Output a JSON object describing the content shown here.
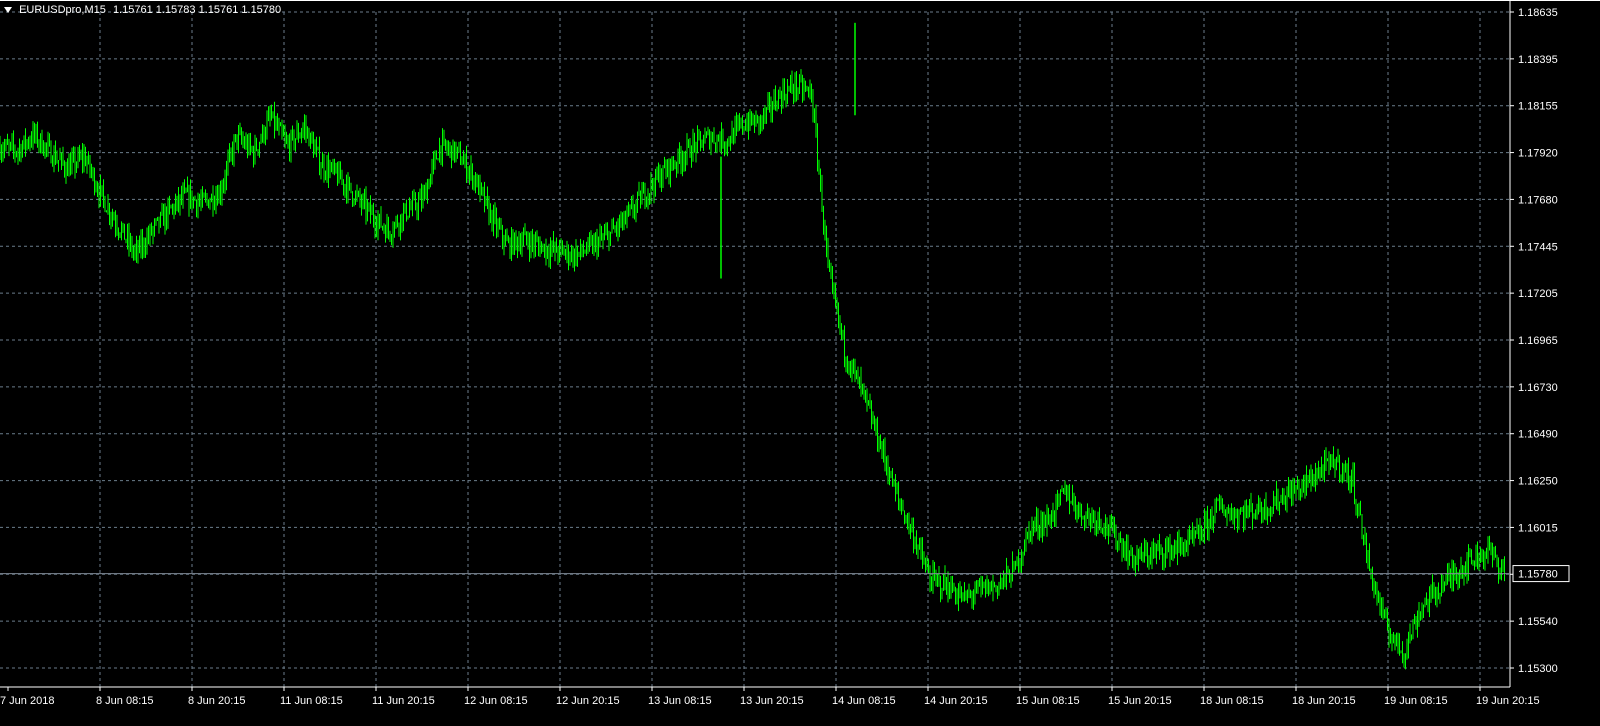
{
  "header": {
    "symbol_timeframe": "EURUSDpro,M15",
    "ohlc": "1.15761 1.15783 1.15761 1.15780"
  },
  "colors": {
    "background": "#000000",
    "grid": "#6b7d8c",
    "bars": "#00ff00",
    "text": "#ffffff",
    "axis_border": "#ffffff"
  },
  "chart_data": {
    "type": "line",
    "title": "EURUSDpro,M15",
    "series": [],
    "ylim": [
      1.153,
      1.18635
    ],
    "y_ticks": [
      "1.18635",
      "1.18395",
      "1.18155",
      "1.17920",
      "1.17680",
      "1.17445",
      "1.17205",
      "1.16965",
      "1.16730",
      "1.16490",
      "1.16250",
      "1.16015",
      "1.15780",
      "1.15540",
      "1.15300"
    ],
    "x_ticks": [
      "7 Jun 2018",
      "8 Jun 08:15",
      "8 Jun 20:15",
      "11 Jun 08:15",
      "11 Jun 20:15",
      "12 Jun 08:15",
      "12 Jun 20:15",
      "13 Jun 08:15",
      "13 Jun 20:15",
      "14 Jun 08:15",
      "14 Jun 20:15",
      "15 Jun 08:15",
      "15 Jun 20:15",
      "18 Jun 08:15",
      "18 Jun 20:15",
      "19 Jun 08:15",
      "19 Jun 20:15"
    ],
    "current_price": "1.15780",
    "price_path": [
      [
        0,
        1.1795
      ],
      [
        1,
        1.1793
      ],
      [
        2,
        1.1801
      ],
      [
        3,
        1.1792
      ],
      [
        4,
        1.1784
      ],
      [
        5,
        1.179
      ],
      [
        6,
        1.177
      ],
      [
        7,
        1.1755
      ],
      [
        8,
        1.174
      ],
      [
        9,
        1.1752
      ],
      [
        10,
        1.1762
      ],
      [
        11,
        1.177
      ],
      [
        12,
        1.1766
      ],
      [
        13,
        1.1772
      ],
      [
        14,
        1.18
      ],
      [
        15,
        1.1792
      ],
      [
        16,
        1.181
      ],
      [
        17,
        1.1795
      ],
      [
        18,
        1.1805
      ],
      [
        19,
        1.1786
      ],
      [
        20,
        1.178
      ],
      [
        21,
        1.177
      ],
      [
        22,
        1.176
      ],
      [
        23,
        1.1752
      ],
      [
        24,
        1.1762
      ],
      [
        25,
        1.1768
      ],
      [
        26,
        1.1795
      ],
      [
        27,
        1.1792
      ],
      [
        28,
        1.178
      ],
      [
        29,
        1.176
      ],
      [
        30,
        1.1745
      ],
      [
        31,
        1.1748
      ],
      [
        32,
        1.1744
      ],
      [
        33,
        1.1742
      ],
      [
        34,
        1.174
      ],
      [
        35,
        1.1744
      ],
      [
        36,
        1.175
      ],
      [
        37,
        1.1758
      ],
      [
        38,
        1.177
      ],
      [
        39,
        1.178
      ],
      [
        40,
        1.1788
      ],
      [
        41,
        1.1795
      ],
      [
        42,
        1.18
      ],
      [
        43,
        1.1798
      ],
      [
        44,
        1.1807
      ],
      [
        45,
        1.1808
      ],
      [
        46,
        1.182
      ],
      [
        47,
        1.1826
      ],
      [
        48,
        1.1822
      ],
      [
        49,
        1.173
      ],
      [
        50,
        1.169
      ],
      [
        51,
        1.167
      ],
      [
        52,
        1.1645
      ],
      [
        53,
        1.1618
      ],
      [
        54,
        1.1598
      ],
      [
        55,
        1.1575
      ],
      [
        56,
        1.1572
      ],
      [
        57,
        1.1565
      ],
      [
        58,
        1.157
      ],
      [
        59,
        1.1572
      ],
      [
        60,
        1.158
      ],
      [
        61,
        1.1602
      ],
      [
        62,
        1.1605
      ],
      [
        63,
        1.162
      ],
      [
        64,
        1.1608
      ],
      [
        65,
        1.1606
      ],
      [
        66,
        1.1597
      ],
      [
        67,
        1.1585
      ],
      [
        68,
        1.1588
      ],
      [
        69,
        1.159
      ],
      [
        70,
        1.1592
      ],
      [
        71,
        1.1598
      ],
      [
        72,
        1.1612
      ],
      [
        73,
        1.1608
      ],
      [
        74,
        1.161
      ],
      [
        75,
        1.1612
      ],
      [
        76,
        1.1618
      ],
      [
        77,
        1.1622
      ],
      [
        78,
        1.163
      ],
      [
        79,
        1.1635
      ],
      [
        80,
        1.1625
      ],
      [
        81,
        1.158
      ],
      [
        82,
        1.155
      ],
      [
        83,
        1.1538
      ],
      [
        84,
        1.156
      ],
      [
        85,
        1.157
      ],
      [
        86,
        1.1578
      ],
      [
        87,
        1.1585
      ],
      [
        88,
        1.159
      ],
      [
        89,
        1.1578
      ]
    ]
  }
}
